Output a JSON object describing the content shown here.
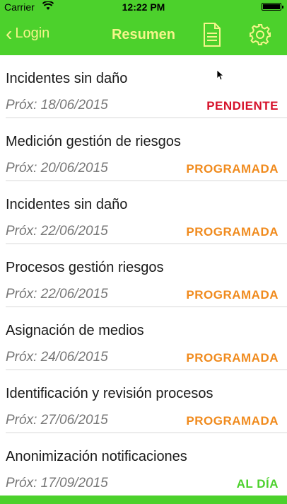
{
  "status_bar": {
    "carrier": "Carrier",
    "time": "12:22 PM"
  },
  "navbar": {
    "back_label": "Login",
    "title": "Resumen",
    "doc_icon": "document-icon",
    "settings_icon": "gear-icon",
    "accent_color": "#4cd12c",
    "text_color": "#f4f58a"
  },
  "items": [
    {
      "title": "Incidentes sin daño",
      "date": "Próx: 18/06/2015",
      "status": "PENDIENTE",
      "status_type": "pendiente"
    },
    {
      "title": "Medición gestión de riesgos",
      "date": "Próx: 20/06/2015",
      "status": "PROGRAMADA",
      "status_type": "programada"
    },
    {
      "title": "Incidentes sin daño",
      "date": "Próx: 22/06/2015",
      "status": "PROGRAMADA",
      "status_type": "programada"
    },
    {
      "title": "Procesos gestión riesgos",
      "date": "Próx: 22/06/2015",
      "status": "PROGRAMADA",
      "status_type": "programada"
    },
    {
      "title": "Asignación de medios",
      "date": "Próx: 24/06/2015",
      "status": "PROGRAMADA",
      "status_type": "programada"
    },
    {
      "title": "Identificación y revisión procesos",
      "date": "Próx: 27/06/2015",
      "status": "PROGRAMADA",
      "status_type": "programada"
    },
    {
      "title": "Anonimización notificaciones",
      "date": "Próx: 17/09/2015",
      "status": "AL DÍA",
      "status_type": "aldia"
    }
  ],
  "status_colors": {
    "pendiente": "#d6112a",
    "programada": "#f08a1c",
    "aldia": "#4cd12c"
  }
}
